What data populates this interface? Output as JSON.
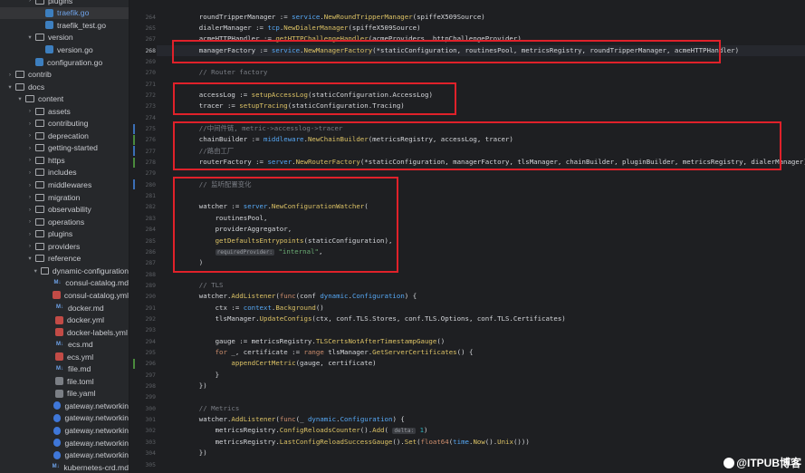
{
  "sidebar": {
    "items": [
      {
        "label": "plugins",
        "type": "folder",
        "depth": 3,
        "expanded": false
      },
      {
        "label": "traefik.go",
        "type": "go",
        "depth": 4,
        "selected": true
      },
      {
        "label": "traefik_test.go",
        "type": "go",
        "depth": 4
      },
      {
        "label": "version",
        "type": "folder",
        "depth": 3,
        "expanded": true
      },
      {
        "label": "version.go",
        "type": "go",
        "depth": 4
      },
      {
        "label": "configuration.go",
        "type": "go",
        "depth": 3
      },
      {
        "label": "contrib",
        "type": "folder",
        "depth": 1,
        "expanded": false
      },
      {
        "label": "docs",
        "type": "folder",
        "depth": 1,
        "expanded": true
      },
      {
        "label": "content",
        "type": "folder",
        "depth": 2,
        "expanded": true
      },
      {
        "label": "assets",
        "type": "folder",
        "depth": 3,
        "expanded": false
      },
      {
        "label": "contributing",
        "type": "folder",
        "depth": 3,
        "expanded": false
      },
      {
        "label": "deprecation",
        "type": "folder",
        "depth": 3,
        "expanded": false
      },
      {
        "label": "getting-started",
        "type": "folder",
        "depth": 3,
        "expanded": false
      },
      {
        "label": "https",
        "type": "folder",
        "depth": 3,
        "expanded": false
      },
      {
        "label": "includes",
        "type": "folder",
        "depth": 3,
        "expanded": false
      },
      {
        "label": "middlewares",
        "type": "folder",
        "depth": 3,
        "expanded": false
      },
      {
        "label": "migration",
        "type": "folder",
        "depth": 3,
        "expanded": false
      },
      {
        "label": "observability",
        "type": "folder",
        "depth": 3,
        "expanded": false
      },
      {
        "label": "operations",
        "type": "folder",
        "depth": 3,
        "expanded": false
      },
      {
        "label": "plugins",
        "type": "folder",
        "depth": 3,
        "expanded": false
      },
      {
        "label": "providers",
        "type": "folder",
        "depth": 3,
        "expanded": false
      },
      {
        "label": "reference",
        "type": "folder",
        "depth": 3,
        "expanded": true
      },
      {
        "label": "dynamic-configuration",
        "type": "folder",
        "depth": 4,
        "expanded": true
      },
      {
        "label": "consul-catalog.md",
        "type": "md",
        "depth": 5
      },
      {
        "label": "consul-catalog.yml",
        "type": "yml",
        "depth": 5
      },
      {
        "label": "docker.md",
        "type": "md",
        "depth": 5
      },
      {
        "label": "docker.yml",
        "type": "yml",
        "depth": 5
      },
      {
        "label": "docker-labels.yml",
        "type": "yml",
        "depth": 5
      },
      {
        "label": "ecs.md",
        "type": "md",
        "depth": 5
      },
      {
        "label": "ecs.yml",
        "type": "yml",
        "depth": 5
      },
      {
        "label": "file.md",
        "type": "md",
        "depth": 5
      },
      {
        "label": "file.toml",
        "type": "toml",
        "depth": 5
      },
      {
        "label": "file.yaml",
        "type": "yaml",
        "depth": 5
      },
      {
        "label": "gateway.networkin",
        "type": "net",
        "depth": 5
      },
      {
        "label": "gateway.networkin",
        "type": "net",
        "depth": 5
      },
      {
        "label": "gateway.networkin",
        "type": "net",
        "depth": 5
      },
      {
        "label": "gateway.networkin",
        "type": "net",
        "depth": 5
      },
      {
        "label": "gateway.networkin",
        "type": "net",
        "depth": 5
      },
      {
        "label": "kubernetes-crd.md",
        "type": "md",
        "depth": 5
      }
    ]
  },
  "icons": {
    "md_badge": "M↓"
  },
  "editor": {
    "current_line": "268",
    "lines": [
      {
        "num": "264",
        "tokens": [
          {
            "t": "    roundTripperManager := "
          },
          {
            "t": "service",
            "c": "pk"
          },
          {
            "t": "."
          },
          {
            "t": "NewRoundTripperManager",
            "c": "fn"
          },
          {
            "t": "(spiffeX509Source)"
          }
        ]
      },
      {
        "num": "265",
        "tokens": [
          {
            "t": "    dialerManager := "
          },
          {
            "t": "tcp",
            "c": "pk"
          },
          {
            "t": "."
          },
          {
            "t": "NewDialerManager",
            "c": "fn"
          },
          {
            "t": "(spiffeX509Source)"
          }
        ]
      },
      {
        "num": "267",
        "tokens": [
          {
            "t": "    acmeHTTPHandler := "
          },
          {
            "t": "getHTTPChallengeHandler",
            "c": "fn"
          },
          {
            "t": "(acmeProviders, httpChallengeProvider)"
          }
        ]
      },
      {
        "num": "268",
        "tokens": [
          {
            "t": "    managerFactory := "
          },
          {
            "t": "service",
            "c": "pk"
          },
          {
            "t": "."
          },
          {
            "t": "NewManagerFactory",
            "c": "fn"
          },
          {
            "t": "(*staticConfiguration, routinesPool, metricsRegistry, roundTripperManager, acmeHTTPHandler)"
          }
        ]
      },
      {
        "num": "269",
        "tokens": []
      },
      {
        "num": "270",
        "tokens": [
          {
            "t": "    // Router factory",
            "c": "cm"
          }
        ]
      },
      {
        "num": "271",
        "tokens": []
      },
      {
        "num": "272",
        "tokens": [
          {
            "t": "    accessLog := "
          },
          {
            "t": "setupAccessLog",
            "c": "fn"
          },
          {
            "t": "(staticConfiguration.AccessLog)"
          }
        ]
      },
      {
        "num": "273",
        "tokens": [
          {
            "t": "    tracer := "
          },
          {
            "t": "setupTracing",
            "c": "fn"
          },
          {
            "t": "(staticConfiguration.Tracing)"
          }
        ]
      },
      {
        "num": "274",
        "tokens": []
      },
      {
        "num": "275",
        "tokens": [
          {
            "t": "    //中间件链, metric->accesslog->tracer",
            "c": "cm"
          }
        ]
      },
      {
        "num": "276",
        "tokens": [
          {
            "t": "    chainBuilder := "
          },
          {
            "t": "middleware",
            "c": "pk"
          },
          {
            "t": "."
          },
          {
            "t": "NewChainBuilder",
            "c": "fn"
          },
          {
            "t": "(metricsRegistry, accessLog, tracer)"
          }
        ]
      },
      {
        "num": "277",
        "tokens": [
          {
            "t": "    //路由工厂",
            "c": "cm"
          }
        ]
      },
      {
        "num": "278",
        "tokens": [
          {
            "t": "    routerFactory := "
          },
          {
            "t": "server",
            "c": "pk"
          },
          {
            "t": "."
          },
          {
            "t": "NewRouterFactory",
            "c": "fn"
          },
          {
            "t": "(*staticConfiguration, managerFactory, tlsManager, chainBuilder, pluginBuilder, metricsRegistry, dialerManager)"
          }
        ]
      },
      {
        "num": "279",
        "tokens": []
      },
      {
        "num": "280",
        "tokens": [
          {
            "t": "    // 监听配置变化",
            "c": "cm"
          }
        ]
      },
      {
        "num": "281",
        "tokens": []
      },
      {
        "num": "282",
        "tokens": [
          {
            "t": "    watcher := "
          },
          {
            "t": "server",
            "c": "pk"
          },
          {
            "t": "."
          },
          {
            "t": "NewConfigurationWatcher",
            "c": "fn"
          },
          {
            "t": "("
          }
        ]
      },
      {
        "num": "283",
        "tokens": [
          {
            "t": "        routinesPool,"
          }
        ]
      },
      {
        "num": "284",
        "tokens": [
          {
            "t": "        providerAggregator,"
          }
        ]
      },
      {
        "num": "285",
        "tokens": [
          {
            "t": "        "
          },
          {
            "t": "getDefaultsEntrypoints",
            "c": "fn"
          },
          {
            "t": "(staticConfiguration),"
          }
        ]
      },
      {
        "num": "286",
        "tokens": [
          {
            "t": "        "
          },
          {
            "t": "requiredProvider:",
            "c": "hint"
          },
          {
            "t": " "
          },
          {
            "t": "\"internal\"",
            "c": "str"
          },
          {
            "t": ","
          }
        ]
      },
      {
        "num": "287",
        "tokens": [
          {
            "t": "    )"
          }
        ]
      },
      {
        "num": "288",
        "tokens": []
      },
      {
        "num": "289",
        "tokens": [
          {
            "t": "    // TLS",
            "c": "cm"
          }
        ]
      },
      {
        "num": "290",
        "tokens": [
          {
            "t": "    watcher."
          },
          {
            "t": "AddListener",
            "c": "fn"
          },
          {
            "t": "("
          },
          {
            "t": "func",
            "c": "kw"
          },
          {
            "t": "(conf "
          },
          {
            "t": "dynamic",
            "c": "pk"
          },
          {
            "t": "."
          },
          {
            "t": "Configuration",
            "c": "pk"
          },
          {
            "t": ") {"
          }
        ]
      },
      {
        "num": "291",
        "tokens": [
          {
            "t": "        ctx := "
          },
          {
            "t": "context",
            "c": "pk"
          },
          {
            "t": "."
          },
          {
            "t": "Background",
            "c": "fn"
          },
          {
            "t": "()"
          }
        ]
      },
      {
        "num": "292",
        "tokens": [
          {
            "t": "        tlsManager."
          },
          {
            "t": "UpdateConfigs",
            "c": "fn"
          },
          {
            "t": "(ctx, conf.TLS.Stores, conf.TLS.Options, conf.TLS.Certificates)"
          }
        ]
      },
      {
        "num": "293",
        "tokens": []
      },
      {
        "num": "294",
        "tokens": [
          {
            "t": "        gauge := metricsRegistry."
          },
          {
            "t": "TLSCertsNotAfterTimestampGauge",
            "c": "fn"
          },
          {
            "t": "()"
          }
        ]
      },
      {
        "num": "295",
        "tokens": [
          {
            "t": "        "
          },
          {
            "t": "for",
            "c": "kw"
          },
          {
            "t": " _, certificate := "
          },
          {
            "t": "range",
            "c": "kw"
          },
          {
            "t": " tlsManager."
          },
          {
            "t": "GetServerCertificates",
            "c": "fn"
          },
          {
            "t": "() {"
          }
        ]
      },
      {
        "num": "296",
        "tokens": [
          {
            "t": "            "
          },
          {
            "t": "appendCertMetric",
            "c": "fn"
          },
          {
            "t": "(gauge, certificate)"
          }
        ]
      },
      {
        "num": "297",
        "tokens": [
          {
            "t": "        }"
          }
        ]
      },
      {
        "num": "298",
        "tokens": [
          {
            "t": "    })"
          }
        ]
      },
      {
        "num": "299",
        "tokens": []
      },
      {
        "num": "300",
        "tokens": [
          {
            "t": "    // Metrics",
            "c": "cm"
          }
        ]
      },
      {
        "num": "301",
        "tokens": [
          {
            "t": "    watcher."
          },
          {
            "t": "AddListener",
            "c": "fn"
          },
          {
            "t": "("
          },
          {
            "t": "func",
            "c": "kw"
          },
          {
            "t": "(_ "
          },
          {
            "t": "dynamic",
            "c": "pk"
          },
          {
            "t": "."
          },
          {
            "t": "Configuration",
            "c": "pk"
          },
          {
            "t": ") {"
          }
        ]
      },
      {
        "num": "302",
        "tokens": [
          {
            "t": "        metricsRegistry."
          },
          {
            "t": "ConfigReloadsCounter",
            "c": "fn"
          },
          {
            "t": "()."
          },
          {
            "t": "Add",
            "c": "fn"
          },
          {
            "t": "( "
          },
          {
            "t": "delta:",
            "c": "hint"
          },
          {
            "t": " "
          },
          {
            "t": "1",
            "c": "num"
          },
          {
            "t": ")"
          }
        ]
      },
      {
        "num": "303",
        "tokens": [
          {
            "t": "        metricsRegistry."
          },
          {
            "t": "LastConfigReloadSuccessGauge",
            "c": "fn"
          },
          {
            "t": "()."
          },
          {
            "t": "Set",
            "c": "fn"
          },
          {
            "t": "("
          },
          {
            "t": "float64",
            "c": "kw"
          },
          {
            "t": "("
          },
          {
            "t": "time",
            "c": "pk"
          },
          {
            "t": "."
          },
          {
            "t": "Now",
            "c": "fn"
          },
          {
            "t": "()."
          },
          {
            "t": "Unix",
            "c": "fn"
          },
          {
            "t": "()))"
          }
        ]
      },
      {
        "num": "304",
        "tokens": [
          {
            "t": "    })"
          }
        ]
      },
      {
        "num": "305",
        "tokens": []
      }
    ]
  },
  "watermark": {
    "text": "@ITPUB博客"
  },
  "colors": {
    "highlight_box": "#e0212a",
    "modified_marker": "#4a8a3c",
    "changed_marker": "#3b6fb6"
  }
}
